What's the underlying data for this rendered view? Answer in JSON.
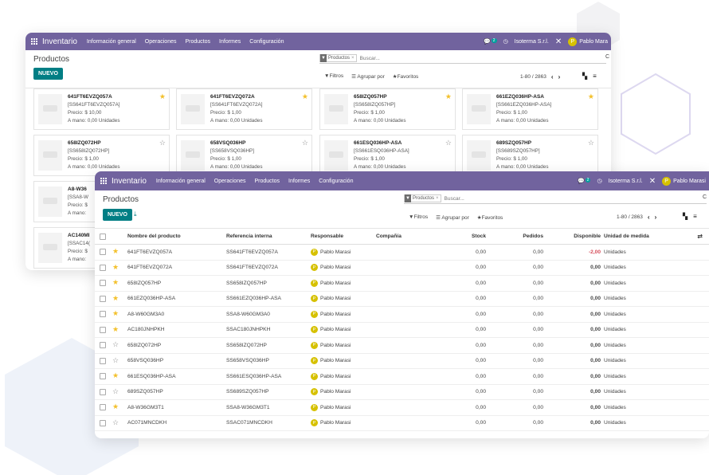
{
  "colors": {
    "navbar": "#71639e",
    "primary_button": "#017e84",
    "star_on": "#f3c02b",
    "negative": "#d44c59",
    "avatar": "#d6c100"
  },
  "navbar": {
    "app_name": "Inventario",
    "menu": [
      "Información general",
      "Operaciones",
      "Productos",
      "Informes",
      "Configuración"
    ],
    "chat_count": "2",
    "company": "Isoterma S.r.l.",
    "user_initial": "P",
    "user_name": "Pablo Marasi",
    "user_name_back": "Pablo Mara"
  },
  "control_panel": {
    "title": "Productos",
    "new_label": "NUEVO",
    "facet_label": "Productos",
    "search_placeholder": "Buscar...",
    "filters_label": "Filtros",
    "group_by_label": "Agrupar por",
    "favorites_label": "Favoritos",
    "pager": "1-80 / 2863",
    "search_tail": "C"
  },
  "kanban": [
    {
      "name": "641FT6EVZQ057A",
      "ref": "[SS641FT6EVZQ057A]",
      "price": "Precio: $ 10,00",
      "onhand": "A mano: 0,00 Unidades",
      "starred": true
    },
    {
      "name": "641FT6EVZQ072A",
      "ref": "[SS641FT6EVZQ072A]",
      "price": "Precio: $ 1,00",
      "onhand": "A mano: 0,00 Unidades",
      "starred": true
    },
    {
      "name": "658IZQ057HP",
      "ref": "[SS658IZQ057HP]",
      "price": "Precio: $ 1,00",
      "onhand": "A mano: 0,00 Unidades",
      "starred": true
    },
    {
      "name": "661EZQ036HP-ASA",
      "ref": "[SS661EZQ036HP-ASA]",
      "price": "Precio: $ 1,00",
      "onhand": "A mano: 0,00 Unidades",
      "starred": true
    },
    {
      "name": "658IZQ072HP",
      "ref": "[SS658IZQ072HP]",
      "price": "Precio: $ 1,00",
      "onhand": "A mano: 0,00 Unidades",
      "starred": false
    },
    {
      "name": "658VSQ036HP",
      "ref": "[SS658VSQ036HP]",
      "price": "Precio: $ 1,00",
      "onhand": "A mano: 0,00 Unidades",
      "starred": false
    },
    {
      "name": "661ESQ036HP-ASA",
      "ref": "[SS661ESQ036HP-ASA]",
      "price": "Precio: $ 1,00",
      "onhand": "A mano: 0,00 Unidades",
      "starred": false
    },
    {
      "name": "689SZQ057HP",
      "ref": "[SS689SZQ057HP]",
      "price": "Precio: $ 1,00",
      "onhand": "A mano: 0,00 Unidades",
      "starred": false
    },
    {
      "name": "A8-W36",
      "ref": "[SSA8-W",
      "price": "Precio: $",
      "onhand": "A mano:",
      "starred": false
    },
    {
      "name": "AC140MI",
      "ref": "[SSAC14(",
      "price": "Precio: $",
      "onhand": "A mano:",
      "starred": false
    }
  ],
  "list": {
    "headers": {
      "name": "Nombre del producto",
      "ref": "Referencia interna",
      "resp": "Responsable",
      "comp": "Compañía",
      "stock": "Stock",
      "ped": "Pedidos",
      "disp": "Disponible",
      "uom": "Unidad de medida"
    },
    "rows": [
      {
        "name": "641FT6EVZQ057A",
        "ref": "SS641FT6EVZQ057A",
        "resp": "Pablo Marasi",
        "stock": "0,00",
        "ped": "0,00",
        "disp": "-2,00",
        "uom": "Unidades",
        "starred": true
      },
      {
        "name": "641FT6EVZQ072A",
        "ref": "SS641FT6EVZQ072A",
        "resp": "Pablo Marasi",
        "stock": "0,00",
        "ped": "0,00",
        "disp": "0,00",
        "uom": "Unidades",
        "starred": true
      },
      {
        "name": "658IZQ057HP",
        "ref": "SS658IZQ057HP",
        "resp": "Pablo Marasi",
        "stock": "0,00",
        "ped": "0,00",
        "disp": "0,00",
        "uom": "Unidades",
        "starred": true
      },
      {
        "name": "661EZQ036HP-ASA",
        "ref": "SS661EZQ036HP-ASA",
        "resp": "Pablo Marasi",
        "stock": "0,00",
        "ped": "0,00",
        "disp": "0,00",
        "uom": "Unidades",
        "starred": true
      },
      {
        "name": "A8-W60GM3A0",
        "ref": "SSA8-W60GM3A0",
        "resp": "Pablo Marasi",
        "stock": "0,00",
        "ped": "0,00",
        "disp": "0,00",
        "uom": "Unidades",
        "starred": true
      },
      {
        "name": "AC180JNHPKH",
        "ref": "SSAC180JNHPKH",
        "resp": "Pablo Marasi",
        "stock": "0,00",
        "ped": "0,00",
        "disp": "0,00",
        "uom": "Unidades",
        "starred": true
      },
      {
        "name": "658IZQ072HP",
        "ref": "SS658IZQ072HP",
        "resp": "Pablo Marasi",
        "stock": "0,00",
        "ped": "0,00",
        "disp": "0,00",
        "uom": "Unidades",
        "starred": false
      },
      {
        "name": "658VSQ036HP",
        "ref": "SS658VSQ036HP",
        "resp": "Pablo Marasi",
        "stock": "0,00",
        "ped": "0,00",
        "disp": "0,00",
        "uom": "Unidades",
        "starred": false
      },
      {
        "name": "661ESQ036HP-ASA",
        "ref": "SS661ESQ036HP-ASA",
        "resp": "Pablo Marasi",
        "stock": "0,00",
        "ped": "0,00",
        "disp": "0,00",
        "uom": "Unidades",
        "starred": true
      },
      {
        "name": "689SZQ057HP",
        "ref": "SS689SZQ057HP",
        "resp": "Pablo Marasi",
        "stock": "0,00",
        "ped": "0,00",
        "disp": "0,00",
        "uom": "Unidades",
        "starred": false
      },
      {
        "name": "A8-W36GM3T1",
        "ref": "SSA8-W36GM3T1",
        "resp": "Pablo Marasi",
        "stock": "0,00",
        "ped": "0,00",
        "disp": "0,00",
        "uom": "Unidades",
        "starred": true
      },
      {
        "name": "AC071MNCDKH",
        "ref": "SSAC071MNCDKH",
        "resp": "Pablo Marasi",
        "stock": "0,00",
        "ped": "0,00",
        "disp": "0,00",
        "uom": "Unidades",
        "starred": false
      }
    ]
  }
}
